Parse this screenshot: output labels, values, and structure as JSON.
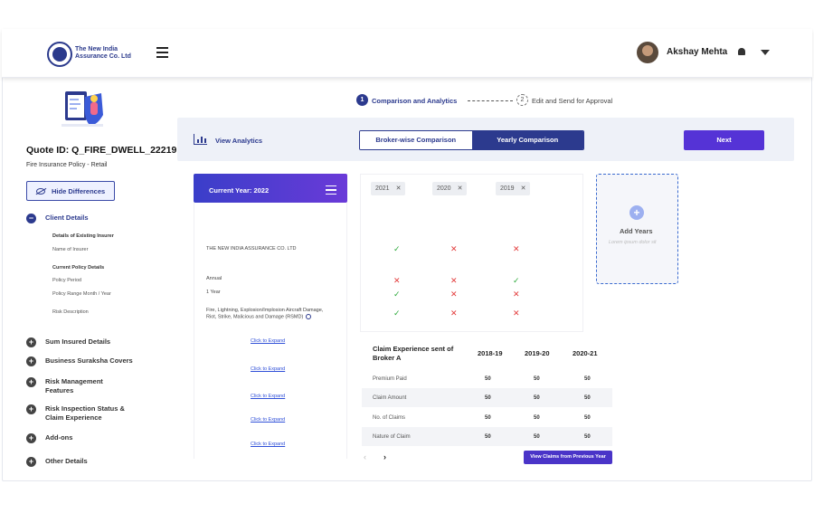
{
  "header": {
    "logo_text": "The New India Assurance Co. Ltd",
    "user_name": "Akshay Mehta"
  },
  "sidebar": {
    "quote_id": "Quote ID: Q_FIRE_DWELL_22219",
    "policy_type": "Fire Insurance Policy - Retail",
    "hide_label": "Hide Differences",
    "client_details": "Client Details",
    "sub_items": [
      "Details of Existing Insurer",
      "Name of Insurer",
      "Current Policy Details",
      "Policy Period",
      "Policy Range Month / Year",
      "Risk Description"
    ],
    "sections": [
      "Sum Insured Details",
      "Business Suraksha Covers",
      "Risk Management Features",
      "Risk Inspection Status & Claim Experience",
      "Add-ons",
      "Other Details"
    ]
  },
  "steps": {
    "step1_num": "1",
    "step1_label": "Comparison and Analytics",
    "step2_num": "2",
    "step2_label": "Edit and Send for Approval"
  },
  "toolbar": {
    "view_analytics": "View Analytics",
    "broker_tab": "Broker-wise Comparison",
    "yearly_tab": "Yearly Comparison",
    "next": "Next"
  },
  "current_year": {
    "title": "Current Year: 2022",
    "insurer": "THE NEW INDIA ASSURANCE CO. LTD",
    "period": "Annual",
    "range": "1 Year",
    "risk": "Fire, Lightning, Explosion/Implosion Aircraft Damage, Riot, Strike, Malicious and Damage (RSMD)",
    "expand": "Click to Expand"
  },
  "years": [
    "2021",
    "2020",
    "2019"
  ],
  "year_marks": {
    "insurer": [
      "ok",
      "no",
      "no"
    ],
    "period": [
      "no",
      "no",
      "ok"
    ],
    "range": [
      "ok",
      "no",
      "no"
    ],
    "risk": [
      "ok",
      "no",
      "no"
    ]
  },
  "add_years": {
    "label": "Add Years",
    "sub": "Lorem ipsum dolor sit"
  },
  "claims": {
    "heading": "Claim Experience sent of Broker A",
    "columns": [
      "2018-19",
      "2019-20",
      "2020-21"
    ],
    "rows": [
      {
        "label": "Premium Paid",
        "values": [
          "50",
          "50",
          "50"
        ]
      },
      {
        "label": "Claim Amount",
        "values": [
          "50",
          "50",
          "50"
        ]
      },
      {
        "label": "No. of Claims",
        "values": [
          "50",
          "50",
          "50"
        ]
      },
      {
        "label": "Nature of Claim",
        "values": [
          "50",
          "50",
          "50"
        ]
      }
    ],
    "view_button": "View Claims from Previous Year"
  },
  "colors": {
    "primary": "#2c3a8e",
    "accent": "#5533d6",
    "ok": "#2eaa3c",
    "no": "#e23a3a"
  }
}
